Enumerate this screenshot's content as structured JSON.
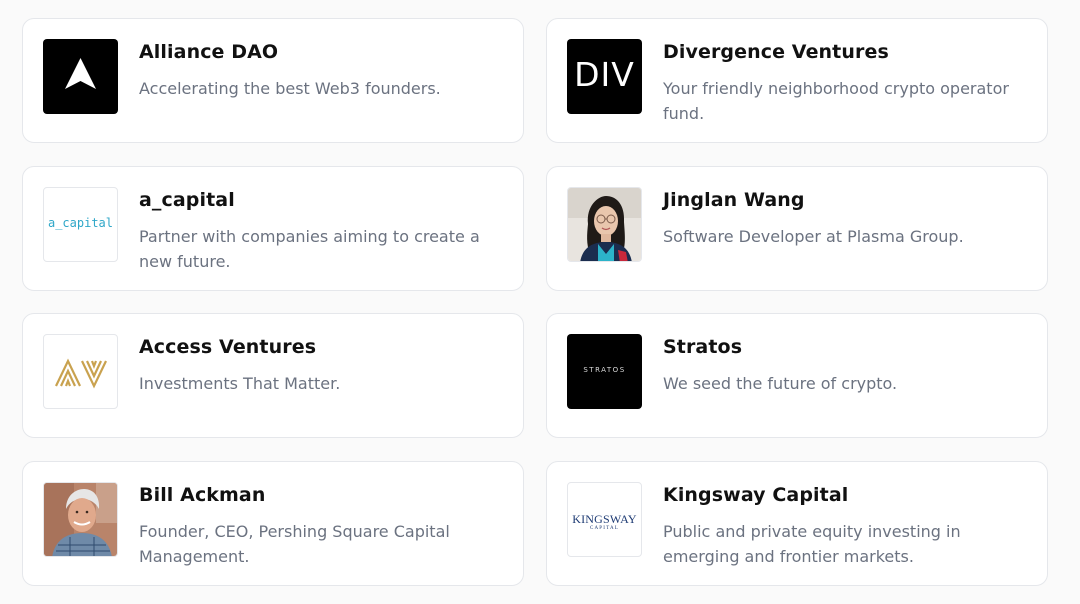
{
  "cards": [
    {
      "title": "Alliance DAO",
      "description": "Accelerating the best Web3 founders.",
      "logo_icon": "alliance-dao-logo"
    },
    {
      "title": "Divergence Ventures",
      "description": "Your friendly neighborhood crypto operator fund.",
      "logo_text": "DIV",
      "logo_icon": "divergence-ventures-logo"
    },
    {
      "title": "a_capital",
      "description": "Partner with companies aiming to create a new future.",
      "logo_text": "a_capital",
      "logo_icon": "a-capital-logo"
    },
    {
      "title": "Jinglan Wang",
      "description": "Software Developer at Plasma Group.",
      "logo_icon": "avatar-photo"
    },
    {
      "title": "Access Ventures",
      "description": "Investments That Matter.",
      "logo_icon": "access-ventures-logo"
    },
    {
      "title": "Stratos",
      "description": "We seed the future of crypto.",
      "logo_text": "STRATOS",
      "logo_icon": "stratos-logo"
    },
    {
      "title": "Bill Ackman",
      "description": "Founder, CEO, Pershing Square Capital Management.",
      "logo_icon": "avatar-photo"
    },
    {
      "title": "Kingsway Capital",
      "description": "Public and private equity investing in emerging and frontier markets.",
      "logo_text": "KINGSWAY",
      "logo_subtext": "CAPITAL",
      "logo_icon": "kingsway-capital-logo"
    }
  ],
  "colors": {
    "title": "#111111",
    "description": "#6b7280",
    "border": "#e5e7eb",
    "a_capital_logo": "#2fa7c8",
    "access_ventures_logo": "#c9a24f",
    "kingsway_logo": "#1d3a73"
  }
}
